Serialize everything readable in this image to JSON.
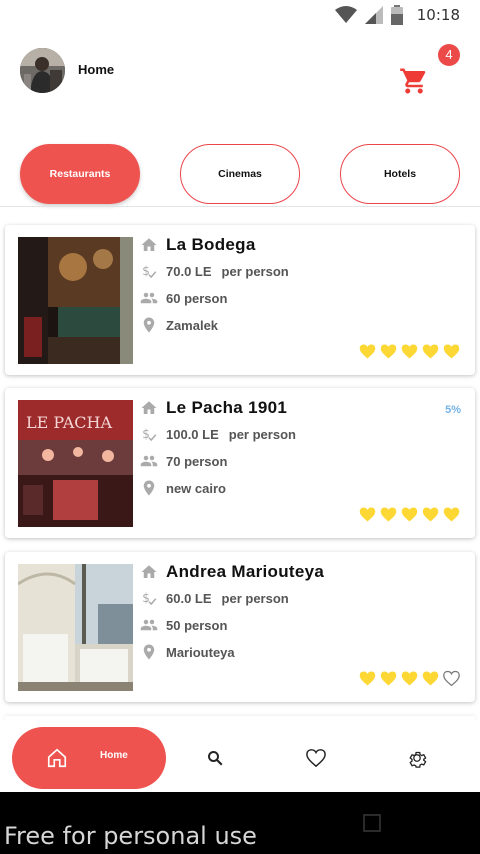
{
  "status_bar": {
    "time": "10:18",
    "icons": [
      "wifi-icon",
      "signal-icon",
      "battery-icon"
    ]
  },
  "header": {
    "title": "Home",
    "cart_count": "4"
  },
  "tabs": [
    {
      "label": "Restaurants",
      "active": true
    },
    {
      "label": "Cinemas",
      "active": false
    },
    {
      "label": "Hotels",
      "active": false
    }
  ],
  "venues": [
    {
      "name": "La Bodega",
      "price": "70.0 LE",
      "per": "per person",
      "capacity": "60 person",
      "location": "Zamalek",
      "discount": "",
      "rating": 5
    },
    {
      "name": "Le Pacha 1901",
      "price": "100.0 LE",
      "per": "per person",
      "capacity": "70 person",
      "location": "new cairo",
      "discount": "5%",
      "rating": 5
    },
    {
      "name": "Andrea Mariouteya",
      "price": "60.0 LE",
      "per": "per person",
      "capacity": "50 person",
      "location": "Mariouteya",
      "discount": "",
      "rating": 4
    }
  ],
  "bottom_nav": {
    "home_label": "Home",
    "items": [
      "home-icon",
      "search-icon",
      "heart-icon",
      "gear-icon"
    ]
  },
  "watermark": "Free for personal use",
  "colors": {
    "accent": "#ef5350",
    "heart_filled": "#fdd835",
    "discount": "#74b3e7"
  }
}
